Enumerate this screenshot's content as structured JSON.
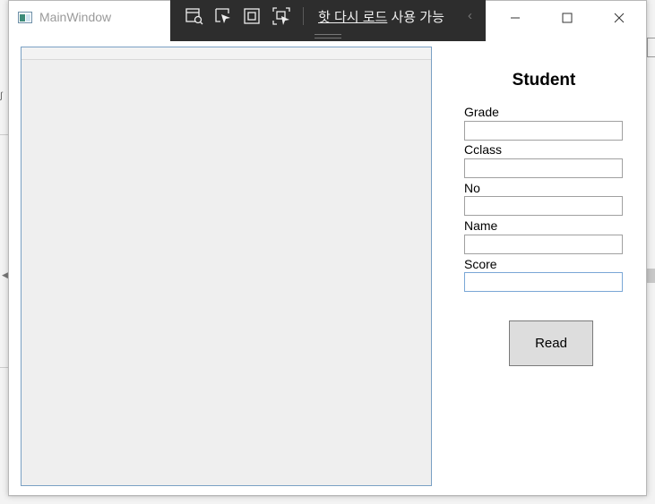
{
  "window": {
    "title": "MainWindow"
  },
  "debug_toolbar": {
    "hot_reload_underlined": "핫 다시 로드",
    "hot_reload_rest": " 사용 가능",
    "icons": [
      "live-visual-tree-icon",
      "select-element-icon",
      "display-adorners-icon",
      "track-focus-icon"
    ]
  },
  "form": {
    "title": "Student",
    "fields": [
      {
        "label": "Grade",
        "value": ""
      },
      {
        "label": "Cclass",
        "value": ""
      },
      {
        "label": "No",
        "value": ""
      },
      {
        "label": "Name",
        "value": ""
      },
      {
        "label": "Score",
        "value": ""
      }
    ],
    "read_button": "Read"
  },
  "colors": {
    "toolbar_bg": "#2d2d2d",
    "grid_bg": "#efefef",
    "grid_border": "#7aa0c4",
    "button_bg": "#dddddd"
  }
}
